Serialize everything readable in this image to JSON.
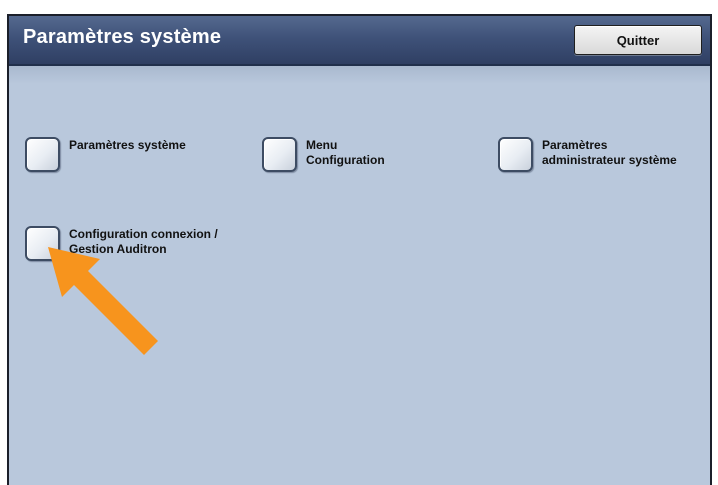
{
  "header": {
    "title": "Paramètres système",
    "quit_label": "Quitter"
  },
  "options": [
    {
      "label": "Paramètres système"
    },
    {
      "label": "Menu\nConfiguration"
    },
    {
      "label": "Paramètres\nadministrateur système"
    },
    {
      "label": "Configuration connexion /\nGestion Auditron"
    }
  ],
  "annotation": {
    "arrow_color": "#f7941d",
    "points_to": "Configuration connexion / Gestion Auditron"
  },
  "colors": {
    "titlebar": "#3f5279",
    "panel_background": "#b9c8dc"
  }
}
